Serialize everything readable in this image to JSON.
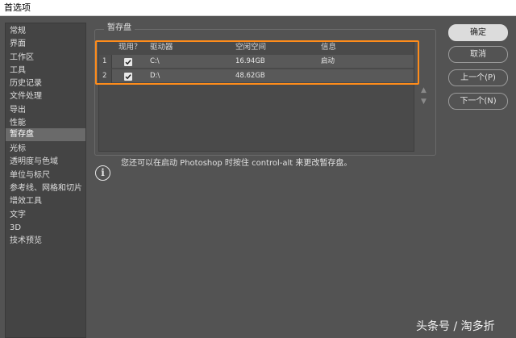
{
  "window": {
    "title": "首选项"
  },
  "sidebar": {
    "items": [
      {
        "label": "常规"
      },
      {
        "label": "界面"
      },
      {
        "label": "工作区"
      },
      {
        "label": "工具"
      },
      {
        "label": "历史记录"
      },
      {
        "label": "文件处理"
      },
      {
        "label": "导出"
      },
      {
        "label": "性能"
      },
      {
        "label": "暂存盘",
        "selected": true
      },
      {
        "label": "光标"
      },
      {
        "label": "透明度与色域"
      },
      {
        "label": "单位与标尺"
      },
      {
        "label": "参考线、网格和切片"
      },
      {
        "label": "增效工具"
      },
      {
        "label": "文字"
      },
      {
        "label": "3D"
      },
      {
        "label": "技术预览"
      }
    ]
  },
  "scratch": {
    "group_title": "暂存盘",
    "columns": [
      "现用？",
      "驱动器",
      "空闲空间",
      "信息"
    ],
    "rows": [
      {
        "index": "1",
        "active": true,
        "drive": "C:\\",
        "free": "16.94GB",
        "info": "启动"
      },
      {
        "index": "2",
        "active": true,
        "drive": "D:\\",
        "free": "48.62GB",
        "info": ""
      }
    ],
    "info_text": "您还可以在启动 Photoshop 时按住 control-alt 来更改暂存盘。",
    "highlight_color": "#ff8c1a"
  },
  "buttons": {
    "ok": "确定",
    "cancel": "取消",
    "prev": "上一个(P)",
    "next": "下一个(N)"
  },
  "watermark": "头条号 / 淘多折"
}
